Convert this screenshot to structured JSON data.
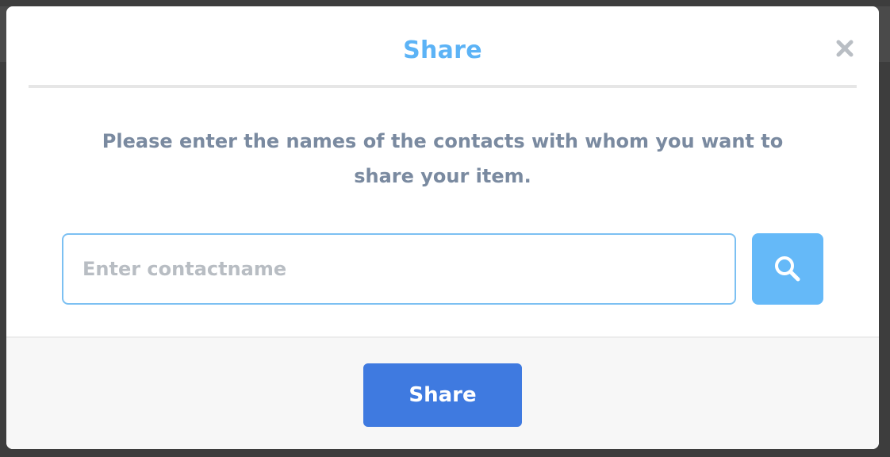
{
  "dialog": {
    "title": "Share",
    "message": "Please enter the names of the contacts with whom you want to share your item.",
    "search": {
      "placeholder": "Enter contactname",
      "value": ""
    },
    "submit_label": "Share",
    "icons": {
      "close": "close-icon",
      "search": "search-icon"
    }
  },
  "colors": {
    "title": "#5cb3f6",
    "message": "#7a8aa0",
    "input_border": "#7cc0f2",
    "search_button": "#65b9f8",
    "share_button": "#3f7ae0",
    "footer_bg": "#f7f7f7"
  }
}
